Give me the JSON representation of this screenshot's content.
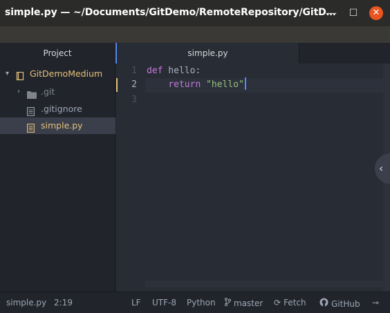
{
  "window": {
    "title": "simple.py — ~/Documents/GitDemo/RemoteRepository/GitD…",
    "minimize_label": "—",
    "maximize_label": "☐",
    "close_label": "✕"
  },
  "tree": {
    "header": "Project",
    "items": [
      {
        "label": "GitDemoMedium",
        "icon": "repo-icon",
        "color": "#e5c07b"
      },
      {
        "label": ".git",
        "icon": "folder-icon",
        "color": "#7f848e"
      },
      {
        "label": ".gitignore",
        "icon": "file-icon",
        "color": "#9da5b4"
      },
      {
        "label": "simple.py",
        "icon": "file-icon",
        "color": "#e5c07b"
      }
    ]
  },
  "tabs": [
    {
      "label": "simple.py",
      "active": true
    }
  ],
  "editor": {
    "line_numbers": [
      "1",
      "2",
      "3"
    ],
    "active_line": "2",
    "lines": [
      {
        "keyword": "def",
        "rest": " hello:"
      },
      {
        "indent": "    ",
        "keyword": "return",
        "string": "\"hello\""
      },
      {}
    ]
  },
  "status": {
    "file": "simple.py",
    "cursor_position": "2:19",
    "line_ending": "LF",
    "encoding": "UTF-8",
    "grammar": "Python",
    "branch": "master",
    "fetch": "Fetch",
    "github": "GitHub",
    "git_icon": "git-commit-icon"
  },
  "colors": {
    "accent": "#568af2",
    "close_button": "#e95420",
    "modified": "#e5c07b"
  }
}
